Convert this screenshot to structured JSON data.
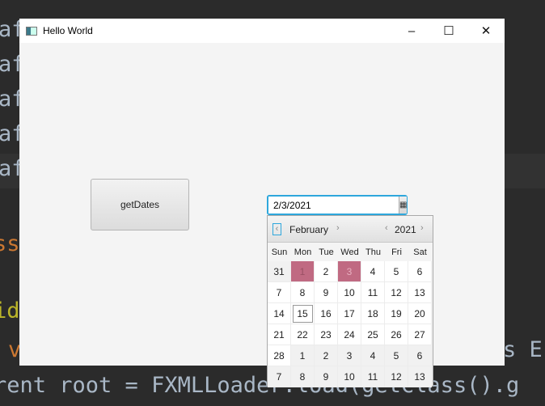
{
  "background_code": {
    "lines": [
      "af",
      "af",
      "af",
      "af",
      "af",
      "ss",
      "id",
      "v",
      "s E",
      "rent root = FXMLLoader.load(getClass().g"
    ]
  },
  "window": {
    "title": "Hello World",
    "minimize": "–",
    "maximize": "☐",
    "close": "✕"
  },
  "button": {
    "label": "getDates"
  },
  "datepicker": {
    "value": "2/3/2021",
    "icon": "calendar-icon"
  },
  "calendar": {
    "month": "February",
    "year": "2021",
    "prev": "‹",
    "next": "›",
    "day_names": [
      "Sun",
      "Mon",
      "Tue",
      "Wed",
      "Thu",
      "Fri",
      "Sat"
    ],
    "selected_color": "#c06a82",
    "weeks": [
      [
        {
          "d": "31",
          "o": 1
        },
        {
          "d": "1",
          "s": 1
        },
        {
          "d": "2"
        },
        {
          "d": "3",
          "s": 2
        },
        {
          "d": "4"
        },
        {
          "d": "5"
        },
        {
          "d": "6"
        }
      ],
      [
        {
          "d": "7"
        },
        {
          "d": "8"
        },
        {
          "d": "9"
        },
        {
          "d": "10"
        },
        {
          "d": "11"
        },
        {
          "d": "12"
        },
        {
          "d": "13"
        }
      ],
      [
        {
          "d": "14"
        },
        {
          "d": "15",
          "t": 1
        },
        {
          "d": "16"
        },
        {
          "d": "17"
        },
        {
          "d": "18"
        },
        {
          "d": "19"
        },
        {
          "d": "20"
        }
      ],
      [
        {
          "d": "21"
        },
        {
          "d": "22"
        },
        {
          "d": "23"
        },
        {
          "d": "24"
        },
        {
          "d": "25"
        },
        {
          "d": "26"
        },
        {
          "d": "27"
        }
      ],
      [
        {
          "d": "28"
        },
        {
          "d": "1",
          "o": 1
        },
        {
          "d": "2",
          "o": 1
        },
        {
          "d": "3",
          "o": 1
        },
        {
          "d": "4",
          "o": 1
        },
        {
          "d": "5",
          "o": 1
        },
        {
          "d": "6",
          "o": 1
        }
      ],
      [
        {
          "d": "7",
          "o": 1
        },
        {
          "d": "8",
          "o": 1
        },
        {
          "d": "9",
          "o": 1
        },
        {
          "d": "10",
          "o": 1
        },
        {
          "d": "11",
          "o": 1
        },
        {
          "d": "12",
          "o": 1
        },
        {
          "d": "13",
          "o": 1
        }
      ]
    ]
  }
}
